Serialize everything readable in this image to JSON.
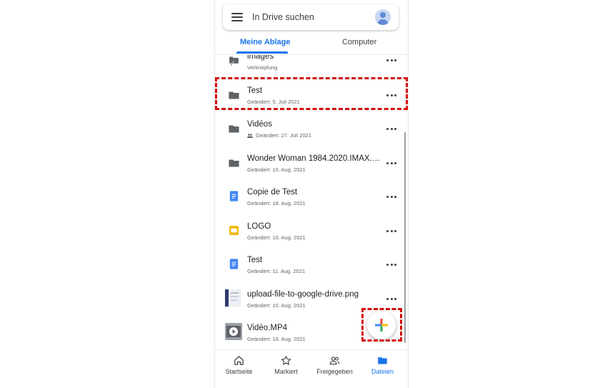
{
  "search": {
    "placeholder": "In Drive suchen",
    "menu_icon": "hamburger-menu-icon",
    "avatar_icon": "account-avatar-icon"
  },
  "tabs": [
    {
      "label": "Meine Ablage",
      "active": true
    },
    {
      "label": "Computer",
      "active": false
    }
  ],
  "files": [
    {
      "name": "images",
      "meta": "Verknüpfung",
      "icon": "shortcut-folder-icon"
    },
    {
      "name": "Test",
      "meta": "Geändert: 5. Juli 2021",
      "icon": "folder-icon"
    },
    {
      "name": "Vidéos",
      "meta": "Geändert: 27. Juli 2021",
      "icon": "folder-icon",
      "shared": true
    },
    {
      "name": "Wonder Woman 1984.2020.IMAX.H...",
      "meta": "Geändert: 10. Aug. 2021",
      "icon": "folder-icon"
    },
    {
      "name": "Copie de Test",
      "meta": "Geändert: 18. Aug. 2021",
      "icon": "google-docs-icon"
    },
    {
      "name": "LOGO",
      "meta": "Geändert: 10. Aug. 2021",
      "icon": "google-slides-icon"
    },
    {
      "name": "Test",
      "meta": "Geändert: 11. Aug. 2021",
      "icon": "google-docs-icon"
    },
    {
      "name": "upload-file-to-google-drive.png",
      "meta": "Geändert: 10. Aug. 2021",
      "icon": "image-thumbnail-icon"
    },
    {
      "name": "Vidéo.MP4",
      "meta": "Geändert: 16. Aug. 2021",
      "icon": "video-thumbnail-icon"
    }
  ],
  "fab": {
    "icon": "plus-icon"
  },
  "bottom_nav": [
    {
      "label": "Startseite",
      "icon": "home-icon",
      "active": false
    },
    {
      "label": "Markiert",
      "icon": "star-icon",
      "active": false
    },
    {
      "label": "Freigegeben",
      "icon": "shared-people-icon",
      "active": false
    },
    {
      "label": "Dateien",
      "icon": "files-folder-icon",
      "active": true
    }
  ],
  "colors": {
    "accent": "#1a73e8",
    "highlight": "#d40b0b",
    "folder": "#5f6368",
    "docs": "#4285f4",
    "slides": "#f4b400"
  }
}
